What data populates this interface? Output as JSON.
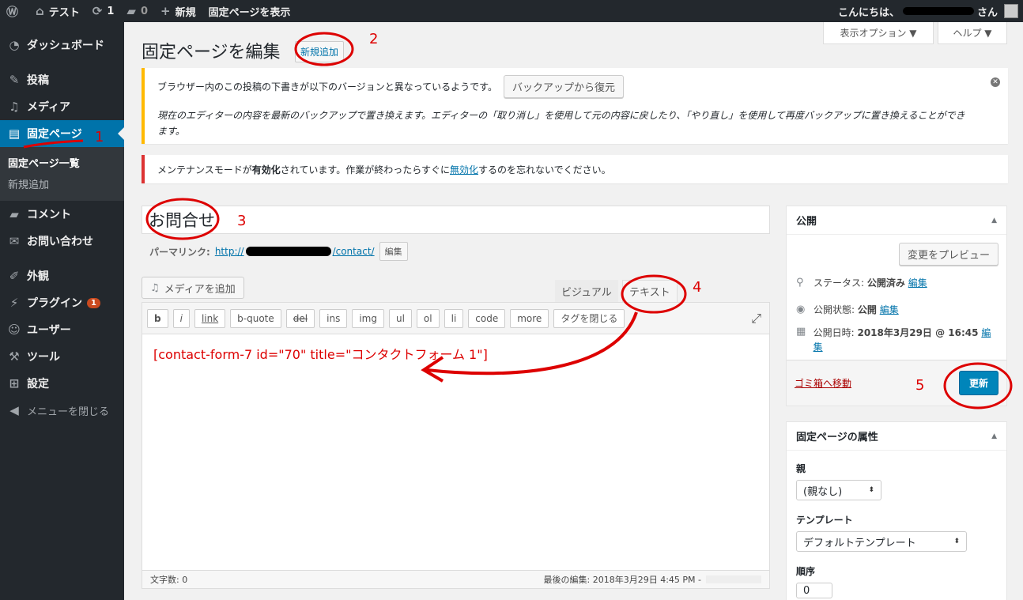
{
  "adminbar": {
    "site_name": "テスト",
    "updates_count": "1",
    "comments_count": "0",
    "new_label": "新規",
    "view_page_label": "固定ページを表示",
    "greeting": "こんにちは、",
    "greeting_suffix": "さん"
  },
  "sidebar": {
    "dashboard": "ダッシュボード",
    "posts": "投稿",
    "media": "メディア",
    "pages": "固定ページ",
    "pages_sub": [
      "固定ページ一覧",
      "新規追加"
    ],
    "comments": "コメント",
    "contact": "お問い合わせ",
    "appearance": "外観",
    "plugins": "プラグイン",
    "plugins_badge": "1",
    "users": "ユーザー",
    "tools": "ツール",
    "settings": "設定",
    "collapse": "メニューを閉じる"
  },
  "header": {
    "screen_options": "表示オプション ▼",
    "help": "ヘルプ ▼",
    "title": "固定ページを編集",
    "add_new": "新規追加"
  },
  "notices": {
    "backup_line1": "ブラウザー内のこの投稿の下書きが以下のバージョンと異なっているようです。",
    "backup_button": "バックアップから復元",
    "backup_line2": "現在のエディターの内容を最新のバックアップで置き換えます。エディターの「取り消し」を使用して元の内容に戻したり、「やり直し」を使用して再度バックアップに置き換えることができます。",
    "maint_a": "メンテナンスモードが",
    "maint_b": "有効化",
    "maint_c": "されています。作業が終わったらすぐに",
    "maint_d": "無効化",
    "maint_e": "するのを忘れないでください。"
  },
  "editor": {
    "title_value": "お問合せ",
    "permalink_label": "パーマリンク:",
    "permalink_prefix": "http://",
    "permalink_suffix": "/contact/",
    "edit_button": "編集",
    "media_button": "メディアを追加",
    "tab_visual": "ビジュアル",
    "tab_text": "テキスト",
    "quicktags": [
      "b",
      "i",
      "link",
      "b-quote",
      "del",
      "ins",
      "img",
      "ul",
      "ol",
      "li",
      "code",
      "more",
      "タグを閉じる"
    ],
    "content": "[contact-form-7 id=\"70\" title=\"コンタクトフォーム 1\"]",
    "word_count": "文字数: 0",
    "last_edited": "最後の編集: 2018年3月29日 4:45 PM -"
  },
  "publish": {
    "heading": "公開",
    "preview_button": "変更をプレビュー",
    "status_label": "ステータス:",
    "status_value": "公開済み",
    "visibility_label": "公開状態:",
    "visibility_value": "公開",
    "date_label": "公開日時:",
    "date_value": "2018年3月29日 @ 16:45",
    "edit_link": "編集",
    "trash": "ゴミ箱へ移動",
    "update": "更新"
  },
  "attributes": {
    "heading": "固定ページの属性",
    "parent_label": "親",
    "parent_value": "(親なし)",
    "template_label": "テンプレート",
    "template_value": "デフォルトテンプレート",
    "order_label": "順序",
    "order_value": "0"
  },
  "annotations": [
    "1",
    "2",
    "3",
    "4",
    "5"
  ],
  "colors": {
    "annotation": "#dd0000",
    "primary": "#0085ba",
    "admin_bg": "#23282d",
    "current_menu": "#0073aa"
  }
}
